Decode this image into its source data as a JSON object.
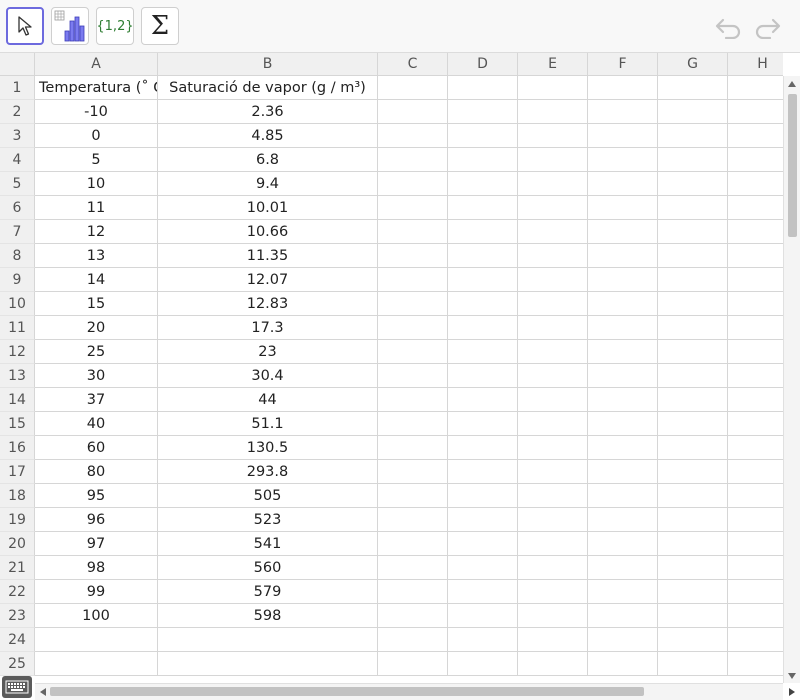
{
  "toolbar": {
    "tools": [
      {
        "name": "move-tool",
        "label": ""
      },
      {
        "name": "chart-tool",
        "label": ""
      },
      {
        "name": "list-tool",
        "label": "{1,2}"
      },
      {
        "name": "sum-tool",
        "label": "Σ"
      }
    ],
    "undo_icon": "undo-icon",
    "redo_icon": "redo-icon"
  },
  "spreadsheet": {
    "columns": [
      "A",
      "B",
      "C",
      "D",
      "E",
      "F",
      "G",
      "H"
    ],
    "rows": [
      [
        "Temperatura (˚ C",
        "Saturació de vapor (g / m³)"
      ],
      [
        "-10",
        "2.36"
      ],
      [
        "0",
        "4.85"
      ],
      [
        "5",
        "6.8"
      ],
      [
        "10",
        "9.4"
      ],
      [
        "11",
        "10.01"
      ],
      [
        "12",
        "10.66"
      ],
      [
        "13",
        "11.35"
      ],
      [
        "14",
        "12.07"
      ],
      [
        "15",
        "12.83"
      ],
      [
        "20",
        "17.3"
      ],
      [
        "25",
        "23"
      ],
      [
        "30",
        "30.4"
      ],
      [
        "37",
        "44"
      ],
      [
        "40",
        "51.1"
      ],
      [
        "60",
        "130.5"
      ],
      [
        "80",
        "293.8"
      ],
      [
        "95",
        "505"
      ],
      [
        "96",
        "523"
      ],
      [
        "97",
        "541"
      ],
      [
        "98",
        "560"
      ],
      [
        "99",
        "579"
      ],
      [
        "100",
        "598"
      ],
      [
        "",
        ""
      ],
      [
        "",
        ""
      ]
    ],
    "row_numbers": [
      "1",
      "2",
      "3",
      "4",
      "5",
      "6",
      "7",
      "8",
      "9",
      "10",
      "11",
      "12",
      "13",
      "14",
      "15",
      "16",
      "17",
      "18",
      "19",
      "20",
      "21",
      "22",
      "23",
      "24",
      "25"
    ]
  },
  "colors": {
    "accent": "#6d6ade",
    "header_bg": "#f0f0f0",
    "grid_line": "#d6d6d6"
  }
}
